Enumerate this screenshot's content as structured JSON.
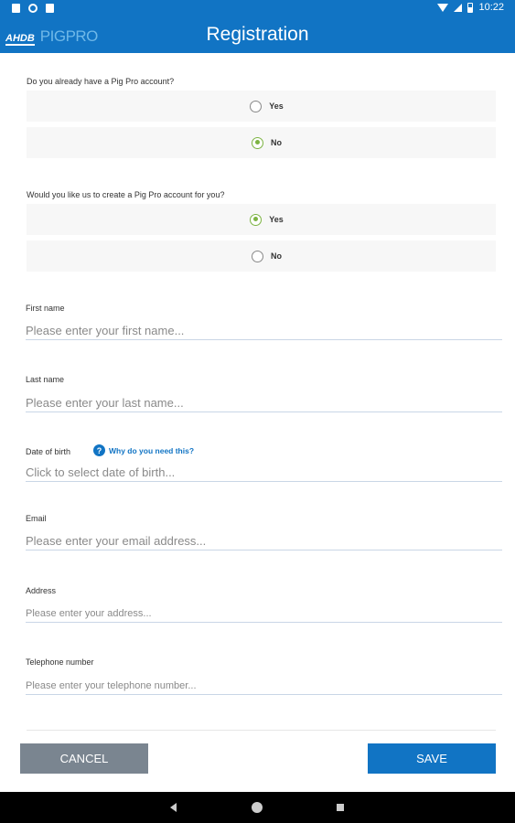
{
  "status_bar": {
    "time": "10:22"
  },
  "app_bar": {
    "logo_left": "AHDB",
    "logo_right": "PIGPRO",
    "title": "Registration"
  },
  "questions": [
    {
      "label": "Do you already have a Pig Pro account?",
      "options": [
        {
          "label": "Yes",
          "checked": false
        },
        {
          "label": "No",
          "checked": true
        }
      ]
    },
    {
      "label": "Would you like us to create a Pig Pro account for you?",
      "options": [
        {
          "label": "Yes",
          "checked": true
        },
        {
          "label": "No",
          "checked": false
        }
      ]
    }
  ],
  "fields": {
    "first_name": {
      "label": "First name",
      "placeholder": "Please enter your first name...",
      "value": ""
    },
    "last_name": {
      "label": "Last name",
      "placeholder": "Please enter your last name...",
      "value": ""
    },
    "dob": {
      "label": "Date of birth",
      "placeholder": "Click to select date of birth...",
      "help_text": "Why do you need this?",
      "help_icon": "?"
    },
    "email": {
      "label": "Email",
      "placeholder": "Please enter your email address...",
      "value": ""
    },
    "address": {
      "label": "Address",
      "placeholder": "Please enter your address...",
      "value": ""
    },
    "telephone": {
      "label": "Telephone number",
      "placeholder": "Please enter your telephone number...",
      "value": ""
    }
  },
  "buttons": {
    "cancel": "CANCEL",
    "save": "SAVE"
  },
  "colors": {
    "primary": "#1174c4",
    "radio_checked": "#7cb342",
    "cancel": "#7a8590"
  }
}
